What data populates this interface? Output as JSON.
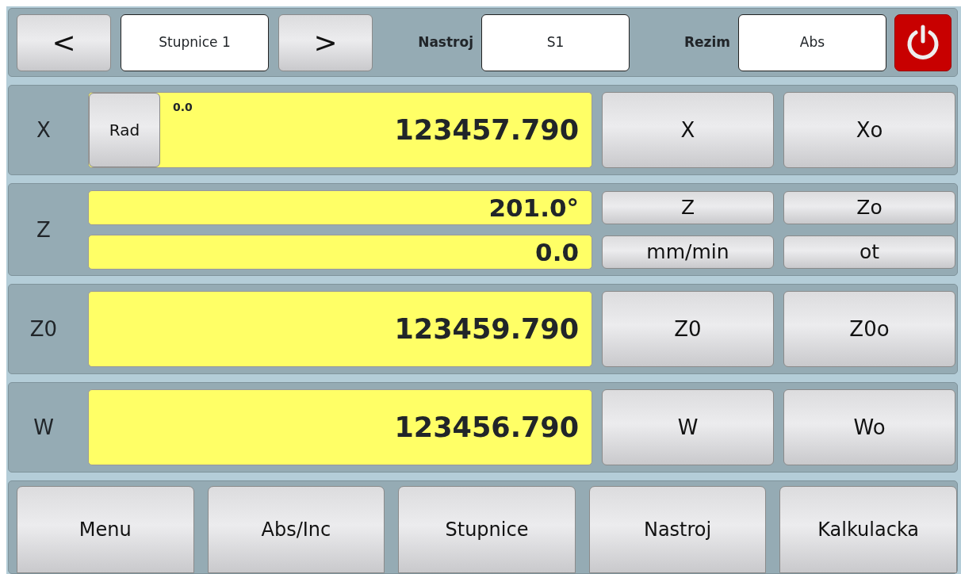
{
  "toolbar": {
    "prev_button": "<",
    "scale_field": "Stupnice 1",
    "next_button": ">",
    "tool_label": "Nastroj",
    "tool_field": "S1",
    "mode_label": "Rezim",
    "mode_field": "Abs"
  },
  "axes": [
    {
      "kind": "single",
      "label": "X",
      "mode_button": "Rad",
      "sub_value": "0.0",
      "value": "123457.790",
      "buttons": [
        "X",
        "Xo"
      ]
    },
    {
      "kind": "double",
      "label": "Z",
      "rows": [
        {
          "value": "201.0°",
          "buttons": [
            "Z",
            "Zo"
          ]
        },
        {
          "value": "0.0",
          "buttons": [
            "mm/min",
            "ot"
          ]
        }
      ]
    },
    {
      "kind": "single",
      "label": "Z0",
      "value": "123459.790",
      "buttons": [
        "Z0",
        "Z0o"
      ]
    },
    {
      "kind": "single",
      "label": "W",
      "value": "123456.790",
      "buttons": [
        "W",
        "Wo"
      ]
    }
  ],
  "bottom_buttons": [
    "Menu",
    "Abs/Inc",
    "Stupnice",
    "Nastroj",
    "Kalkulacka"
  ]
}
